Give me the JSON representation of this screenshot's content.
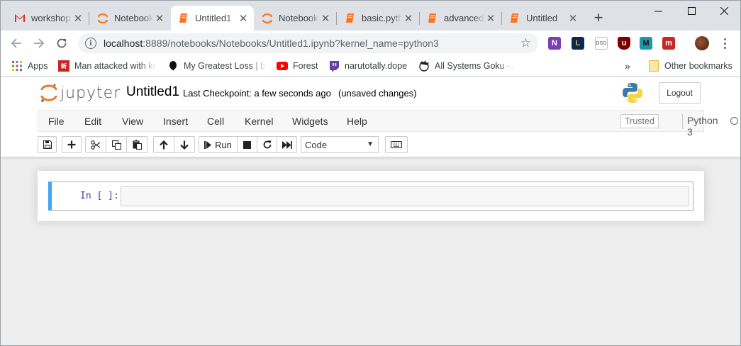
{
  "browser": {
    "tabs": [
      {
        "title": "workshop",
        "icon": "gmail-icon",
        "active": false
      },
      {
        "title": "Notebook",
        "icon": "jupyter-icon",
        "active": false
      },
      {
        "title": "Untitled1",
        "icon": "notebook-icon",
        "active": true
      },
      {
        "title": "Notebook",
        "icon": "jupyter-icon",
        "active": false
      },
      {
        "title": "basic.pyth",
        "icon": "notebook-icon",
        "active": false
      },
      {
        "title": "advanced",
        "icon": "notebook-icon",
        "active": false
      },
      {
        "title": "Untitled",
        "icon": "notebook-icon",
        "active": false
      }
    ],
    "new_tab": "+",
    "window_controls": {
      "minimize": "—",
      "maximize": "☐",
      "close": "✕"
    },
    "url_host": "localhost",
    "url_rest": ":8889/notebooks/Notebooks/Untitled1.ipynb?kernel_name=python3",
    "extensions": [
      "onenote-icon",
      "lol-icon",
      "dsg-icon",
      "ublock-icon",
      "m-icon",
      "mega-icon",
      "profile-avatar"
    ],
    "bookmarks": [
      {
        "label": "Apps",
        "icon": "apps-grid-icon"
      },
      {
        "label": "Man attacked with kn",
        "icon": "news-icon"
      },
      {
        "label": "My Greatest Loss | by",
        "icon": "medium-icon"
      },
      {
        "label": "Forest",
        "icon": "youtube-icon"
      },
      {
        "label": "narutotally.dope",
        "icon": "twitch-icon"
      },
      {
        "label": "All Systems Goku - Al",
        "icon": "goku-icon"
      }
    ],
    "overflow": "»",
    "other_bookmarks": "Other bookmarks"
  },
  "jupyter": {
    "wordmark": "jupyter",
    "notebook_name": "Untitled1",
    "checkpoint": "Last Checkpoint: a few seconds ago",
    "unsaved": "(unsaved changes)",
    "logout": "Logout",
    "menu": [
      "File",
      "Edit",
      "View",
      "Insert",
      "Cell",
      "Kernel",
      "Widgets",
      "Help"
    ],
    "trusted": "Trusted",
    "kernel": "Python 3",
    "run_label": "Run",
    "cell_type": "Code",
    "cell_type_caret": "▼",
    "prompt": "In [ ]:",
    "colors": {
      "cell_border": "#42a5f5",
      "prompt": "#303f9f",
      "accent_orange": "#f37726"
    }
  }
}
